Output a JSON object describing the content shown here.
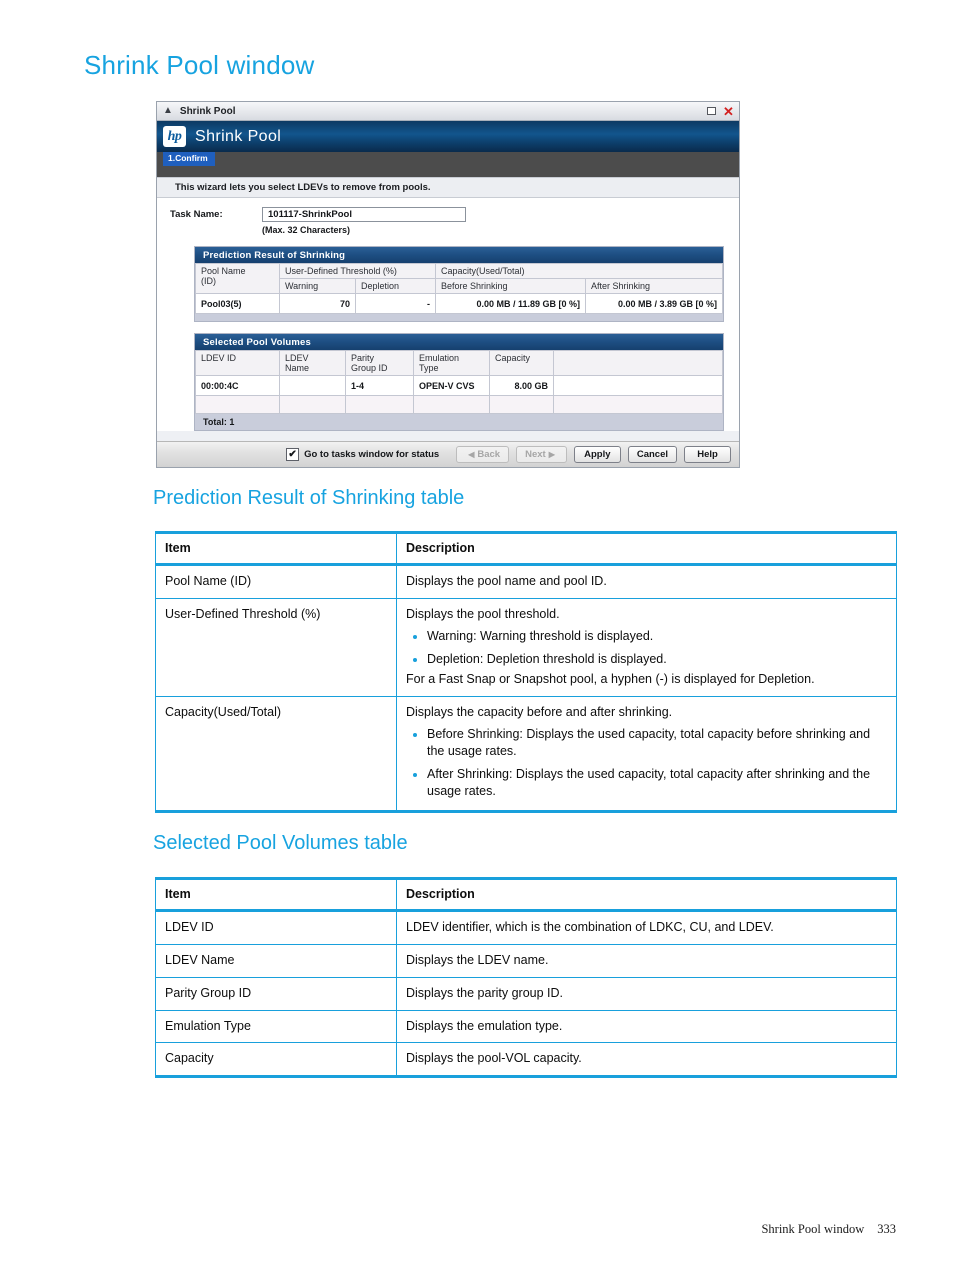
{
  "page": {
    "title": "Shrink Pool window",
    "footer_text": "Shrink Pool window",
    "footer_page_number": "333",
    "accent_color": "#18a0dc"
  },
  "sections": {
    "prediction_title": "Prediction Result of Shrinking table",
    "selected_volumes_title": "Selected Pool Volumes table"
  },
  "dialog": {
    "titlebar": {
      "chevrons_icon": "chevron-up-double-icon",
      "title": "Shrink Pool",
      "maximize_icon": "maximize-icon",
      "close_icon": "close-icon"
    },
    "header": {
      "logo_text": "hp",
      "app_title": "Shrink Pool"
    },
    "step_tab": "1.Confirm",
    "wizard_note": "This wizard lets you select LDEVs to remove from pools.",
    "task": {
      "label": "Task Name:",
      "value": "101117-ShrinkPool",
      "hint": "(Max. 32 Characters)"
    },
    "prediction_panel": {
      "heading": "Prediction Result of Shrinking",
      "group_headers": {
        "pool_name": "Pool Name\n(ID)",
        "pool_name_line1": "Pool Name",
        "pool_name_line2": "(ID)",
        "threshold": "User-Defined Threshold (%)",
        "capacity": "Capacity(Used/Total)"
      },
      "sub_headers": {
        "warning": "Warning",
        "depletion": "Depletion",
        "before": "Before Shrinking",
        "after": "After Shrinking"
      },
      "rows": [
        {
          "pool_name": "Pool03(5)",
          "warning": "70",
          "depletion": "-",
          "before_shrinking": "0.00 MB / 11.89 GB [0 %]",
          "after_shrinking": "0.00 MB / 3.89 GB [0 %]"
        }
      ]
    },
    "volumes_panel": {
      "heading": "Selected Pool Volumes",
      "headers": {
        "ldev_id": "LDEV ID",
        "ldev_name_l1": "LDEV",
        "ldev_name_l2": "Name",
        "parity_l1": "Parity",
        "parity_l2": "Group ID",
        "emulation_l1": "Emulation",
        "emulation_l2": "Type",
        "capacity": "Capacity",
        "blank": ""
      },
      "rows": [
        {
          "ldev_id": "00:00:4C",
          "ldev_name": "",
          "parity_group_id": "1-4",
          "emulation_type": "OPEN-V CVS",
          "capacity": "8.00 GB",
          "extra": ""
        }
      ],
      "total": "Total: 1"
    },
    "footer": {
      "checkbox_checked": "✔",
      "checkbox_label": "Go to tasks window for status",
      "back_label": "Back",
      "next_label": "Next",
      "apply_label": "Apply",
      "cancel_label": "Cancel",
      "help_label": "Help",
      "back_arrow": "◀",
      "next_arrow": "▶"
    }
  },
  "prediction_table": {
    "columns": {
      "item": "Item",
      "description": "Description"
    },
    "rows": [
      {
        "item": "Pool Name (ID)",
        "lead": "Displays the pool name and pool ID.",
        "bullets": [],
        "tail": ""
      },
      {
        "item": "User-Defined Threshold (%)",
        "lead": "Displays the pool threshold.",
        "bullets": [
          "Warning: Warning threshold is displayed.",
          "Depletion: Depletion threshold is displayed."
        ],
        "tail": "For a Fast Snap or Snapshot pool, a hyphen (-) is displayed for Depletion."
      },
      {
        "item": "Capacity(Used/Total)",
        "lead": "Displays the capacity before and after shrinking.",
        "bullets": [
          "Before Shrinking: Displays the used capacity, total capacity before shrinking and the usage rates.",
          "After Shrinking: Displays the used capacity, total capacity after shrinking and the usage rates."
        ],
        "tail": ""
      }
    ]
  },
  "volumes_table": {
    "columns": {
      "item": "Item",
      "description": "Description"
    },
    "rows": [
      {
        "item": "LDEV ID",
        "lead": "LDEV identifier, which is the combination of LDKC, CU, and LDEV.",
        "bullets": [],
        "tail": ""
      },
      {
        "item": "LDEV Name",
        "lead": "Displays the LDEV name.",
        "bullets": [],
        "tail": ""
      },
      {
        "item": "Parity Group ID",
        "lead": "Displays the parity group ID.",
        "bullets": [],
        "tail": ""
      },
      {
        "item": "Emulation Type",
        "lead": "Displays the emulation type.",
        "bullets": [],
        "tail": ""
      },
      {
        "item": "Capacity",
        "lead": "Displays the pool-VOL capacity.",
        "bullets": [],
        "tail": ""
      }
    ]
  }
}
